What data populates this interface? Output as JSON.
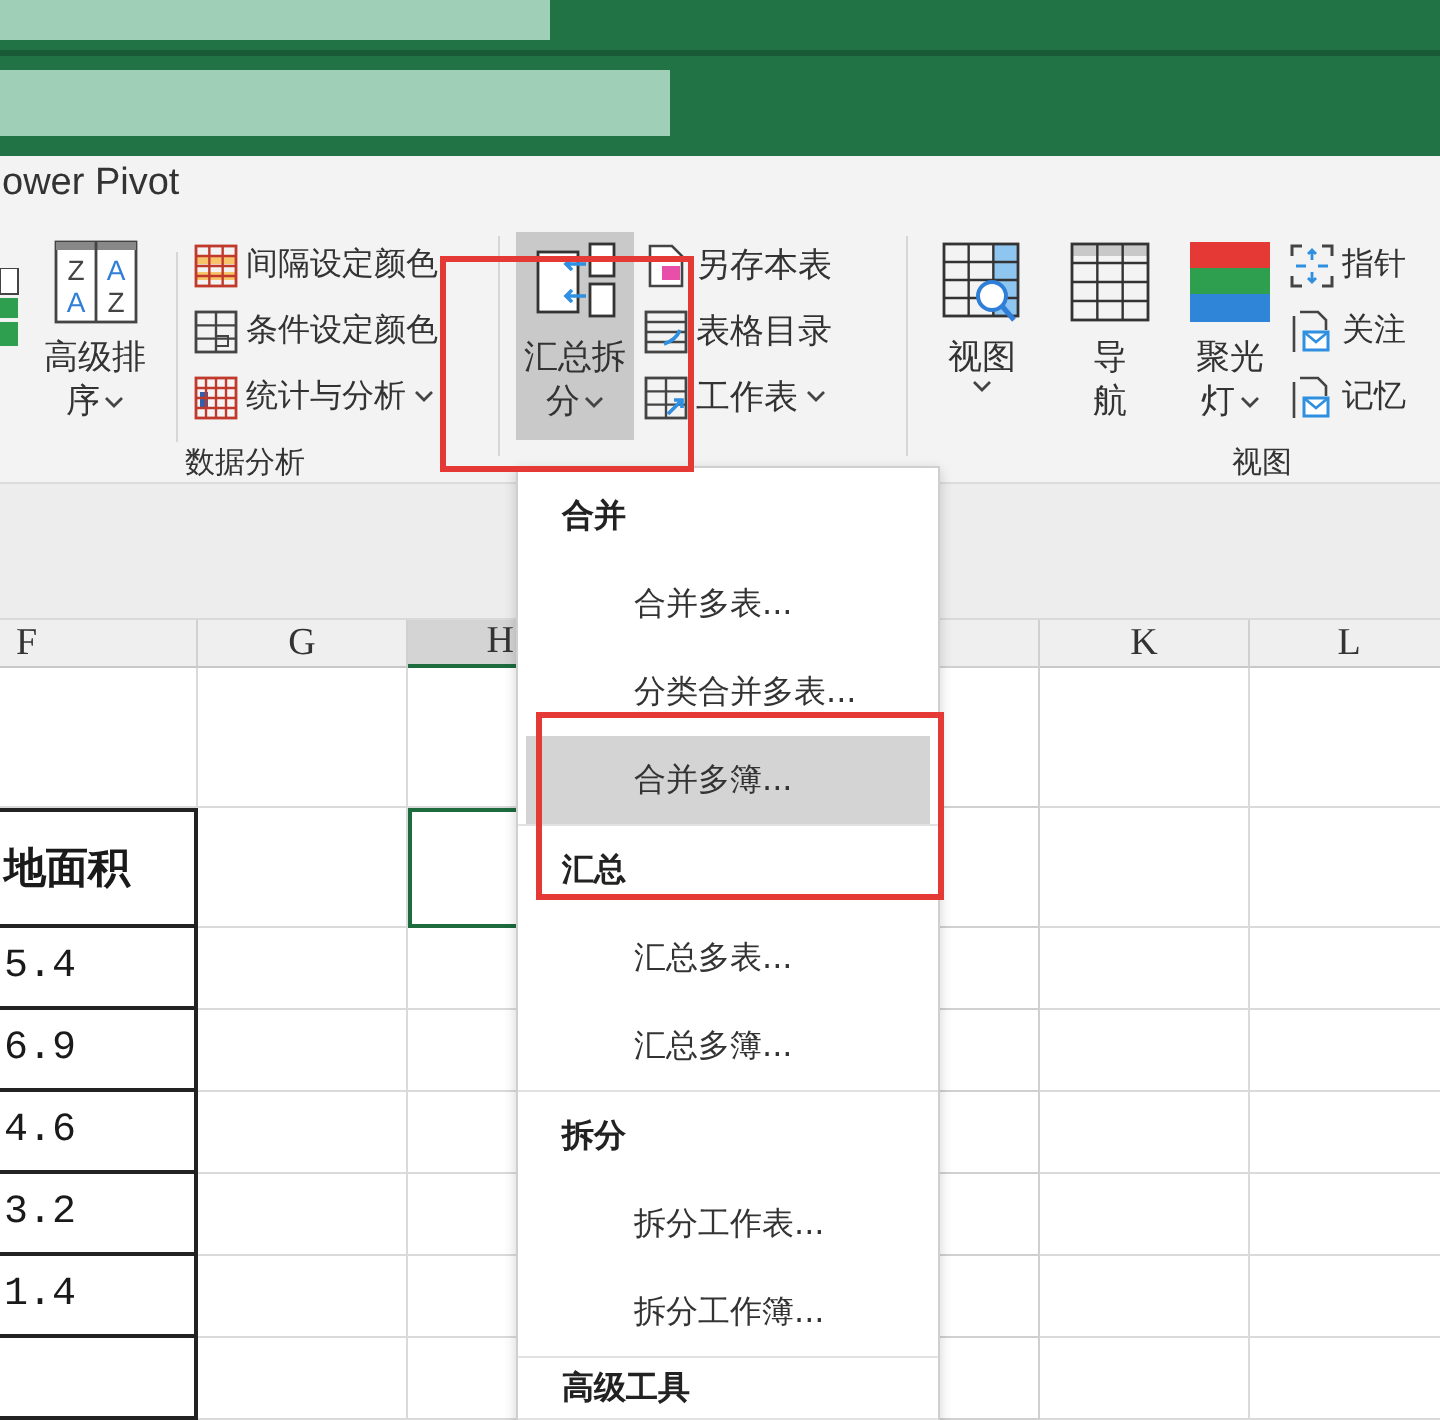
{
  "ribbon_tab": "ower Pivot",
  "ribbon": {
    "groups": [
      {
        "label": "数据分析",
        "items": [
          {
            "kind": "fragment"
          },
          {
            "kind": "large",
            "lines": [
              "高级排",
              "序"
            ],
            "dropdown": true,
            "pressed": false,
            "icon_letters": [
              "Z",
              "A",
              "A",
              "Z"
            ]
          },
          {
            "kind": "separator"
          },
          {
            "kind": "stack",
            "buttons": [
              {
                "label": "间隔设定颜色",
                "dropdown": false
              },
              {
                "label": "条件设定颜色",
                "dropdown": false
              },
              {
                "label": "统计与分析",
                "dropdown": true
              }
            ]
          }
        ]
      },
      {
        "items": [
          {
            "kind": "large",
            "lines": [
              "汇总拆",
              "分"
            ],
            "dropdown": true,
            "pressed": true
          },
          {
            "kind": "stack",
            "buttons": [
              {
                "label": "另存本表",
                "dropdown": false
              },
              {
                "label": "表格目录",
                "dropdown": false
              },
              {
                "label": "工作表",
                "dropdown": true
              }
            ]
          }
        ]
      },
      {
        "label": "视图",
        "items": [
          {
            "kind": "large",
            "lines": [
              "视图"
            ],
            "dropdown": true,
            "pressed": false
          },
          {
            "kind": "large",
            "lines": [
              "导",
              "航"
            ],
            "dropdown": false,
            "pressed": false
          },
          {
            "kind": "large",
            "lines": [
              "聚光",
              "灯"
            ],
            "dropdown": true,
            "pressed": false
          },
          {
            "kind": "stack",
            "buttons": [
              {
                "label": "指针",
                "dropdown": false
              },
              {
                "label": "关注",
                "dropdown": false
              },
              {
                "label": "记忆",
                "dropdown": false
              }
            ]
          }
        ]
      }
    ]
  },
  "sheet": {
    "columns": [
      {
        "label": "F",
        "selected": false
      },
      {
        "label": "G",
        "selected": false
      },
      {
        "label": "H",
        "selected": true
      },
      {
        "label": "K",
        "selected": false
      },
      {
        "label": "L",
        "selected": false
      }
    ],
    "rows": [
      {
        "kind": "blank",
        "cursor": false
      },
      {
        "kind": "header",
        "text": "地面积",
        "cursor": true
      },
      {
        "kind": "value",
        "text": "5.4",
        "cursor": false
      },
      {
        "kind": "value",
        "text": "6.9",
        "cursor": false
      },
      {
        "kind": "value",
        "text": "4.6",
        "cursor": false
      },
      {
        "kind": "value",
        "text": "3.2",
        "cursor": false
      },
      {
        "kind": "value",
        "text": "1.4",
        "cursor": false
      },
      {
        "kind": "boxed",
        "cursor": false
      }
    ]
  },
  "menu": {
    "sections": [
      {
        "heading": "合并",
        "items": [
          {
            "label": "合并多表...",
            "selected": false
          },
          {
            "label": "分类合并多表...",
            "selected": false
          },
          {
            "label": "合并多簿...",
            "selected": true
          }
        ]
      },
      {
        "heading": "汇总",
        "items": [
          {
            "label": "汇总多表...",
            "selected": false
          },
          {
            "label": "汇总多簿...",
            "selected": false
          }
        ]
      },
      {
        "heading": "拆分",
        "items": [
          {
            "label": "拆分工作表...",
            "selected": false
          },
          {
            "label": "拆分工作簿...",
            "selected": false
          }
        ]
      },
      {
        "heading": "高级工具"
      }
    ]
  }
}
